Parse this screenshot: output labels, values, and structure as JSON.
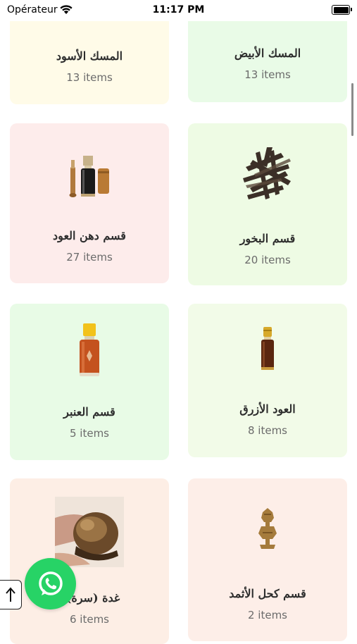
{
  "status_bar": {
    "carrier": "Opérateur",
    "time": "11:17 PM"
  },
  "categories": [
    {
      "title": "المسك الأسود",
      "count": "13 items",
      "bg": "#fffbe8"
    },
    {
      "title": "المسك الأبيض",
      "count": "13 items",
      "bg": "#e9fbe7"
    },
    {
      "title": "قسم دهن العود",
      "count": "27 items",
      "bg": "#fdeceb"
    },
    {
      "title": "قسم البخور",
      "count": "20 items",
      "bg": "#eefbe4"
    },
    {
      "title": "قسم العنبر",
      "count": "5 items",
      "bg": "#e8fbe6"
    },
    {
      "title": "العود الأزرق",
      "count": "8 items",
      "bg": "#f2fbe8"
    },
    {
      "title": "غدة (سرة) ا",
      "count": "6 items",
      "bg": "#fdeee5"
    },
    {
      "title": "قسم كحل الأثمد",
      "count": "2 items",
      "bg": "#fdeee8"
    }
  ],
  "icons": {
    "whatsapp": "whatsapp-icon",
    "scroll_top": "arrow-up-icon"
  }
}
